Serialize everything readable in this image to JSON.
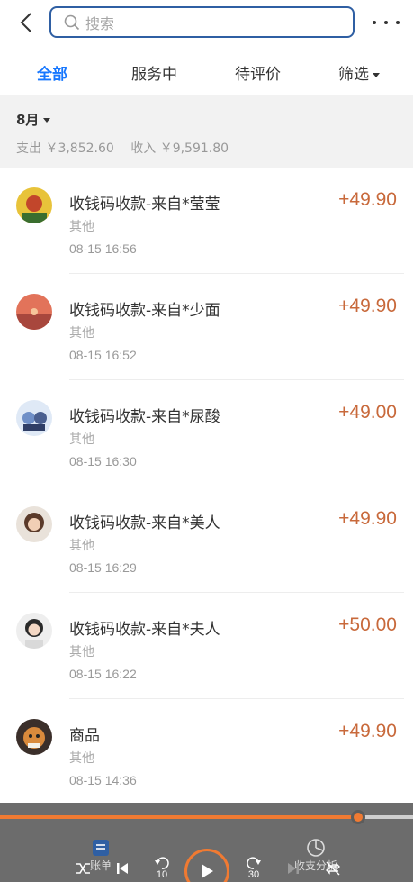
{
  "header": {
    "back_icon": "chevron-left-icon",
    "search_placeholder": "搜索",
    "search_icon": "search-icon",
    "more_icon": "more-dots-icon"
  },
  "tabs": [
    {
      "label": "全部",
      "active": true
    },
    {
      "label": "服务中",
      "active": false
    },
    {
      "label": "待评价",
      "active": false
    },
    {
      "label": "筛选",
      "active": false
    }
  ],
  "month": {
    "label": "8月",
    "expense": "支出 ￥3,852.60",
    "income": "收入 ￥9,591.80"
  },
  "transactions": [
    {
      "title": "收钱码收款-来自*莹莹",
      "category": "其他",
      "time": "08-15 16:56",
      "amount": "+49.90"
    },
    {
      "title": "收钱码收款-来自*少面",
      "category": "其他",
      "time": "08-15 16:52",
      "amount": "+49.90"
    },
    {
      "title": "收钱码收款-来自*尿酸",
      "category": "其他",
      "time": "08-15 16:30",
      "amount": "+49.00"
    },
    {
      "title": "收钱码收款-来自*美人",
      "category": "其他",
      "time": "08-15 16:29",
      "amount": "+49.90"
    },
    {
      "title": "收钱码收款-来自*夫人",
      "category": "其他",
      "time": "08-15 16:22",
      "amount": "+50.00"
    },
    {
      "title": "商品",
      "category": "其他",
      "time": "08-15 14:36",
      "amount": "+49.90"
    }
  ],
  "player": {
    "progress": 0.868,
    "rewind_label": "10",
    "forward_label": "30"
  },
  "bottom_tabs": [
    {
      "label": "账单",
      "icon": "bill-icon"
    },
    {
      "label": "收支分析",
      "icon": "pie-chart-icon"
    }
  ],
  "colors": {
    "accent": "#1677ff",
    "amount": "#c8693b",
    "player_accent": "#f07a32"
  }
}
